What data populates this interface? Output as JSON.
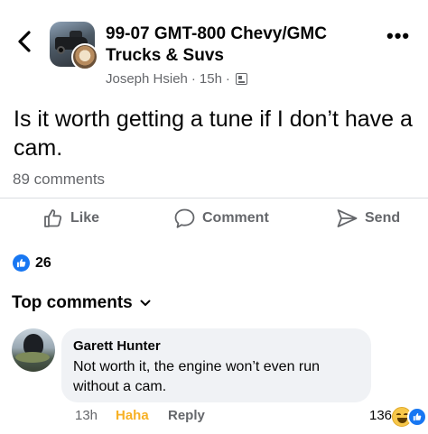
{
  "header": {
    "group_name": "99-07 GMT-800 Chevy/GMC Trucks & Suvs",
    "author": "Joseph Hsieh",
    "separator": "·",
    "time": "15h",
    "more_label": "•••"
  },
  "post": {
    "text": "Is it worth getting a tune if I don’t have a cam.",
    "comment_count_label": "89 comments",
    "reaction_count": "26"
  },
  "actions": {
    "like_label": "Like",
    "comment_label": "Comment",
    "send_label": "Send"
  },
  "comments_section": {
    "header_label": "Top comments",
    "chevron": "⌄"
  },
  "comment": {
    "author": "Garett Hunter",
    "text": "Not worth it, the engine won’t even run without a cam.",
    "time": "13h",
    "reaction_label": "Haha",
    "reply_label": "Reply",
    "reaction_count": "136"
  },
  "colors": {
    "accent": "#1877f2",
    "muted_text": "#65676b",
    "haha": "#f7b125",
    "bubble": "#f0f2f5"
  },
  "icons": [
    "back-chevron-icon",
    "more-options-icon",
    "group-avatar",
    "user-avatar",
    "audience-icon",
    "like-icon",
    "comment-icon",
    "send-icon",
    "like-reaction-icon",
    "chevron-down-icon",
    "haha-reaction-icon"
  ]
}
